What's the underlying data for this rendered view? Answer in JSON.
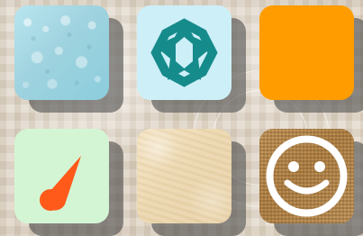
{
  "board": {
    "tiles": [
      {
        "icon": "water-drops-texture"
      },
      {
        "icon": "octagram-icon"
      },
      {
        "icon": "blank-orange-tile"
      },
      {
        "icon": "comet-icon"
      },
      {
        "icon": "paper-texture"
      },
      {
        "icon": "smiley-face-icon"
      }
    ]
  },
  "colors": {
    "background": "#e0d7cb",
    "shadow": "#5b5b5b",
    "water": "#9fd3df",
    "mint": "#cdeff8",
    "teal": "#168b8b",
    "orange": "#ff9d00",
    "pale_green": "#d4f5d4",
    "comet_orange": "#ff5a1a",
    "parchment": "#ecd8b0",
    "burlap": "#b48448",
    "white": "#ffffff"
  }
}
